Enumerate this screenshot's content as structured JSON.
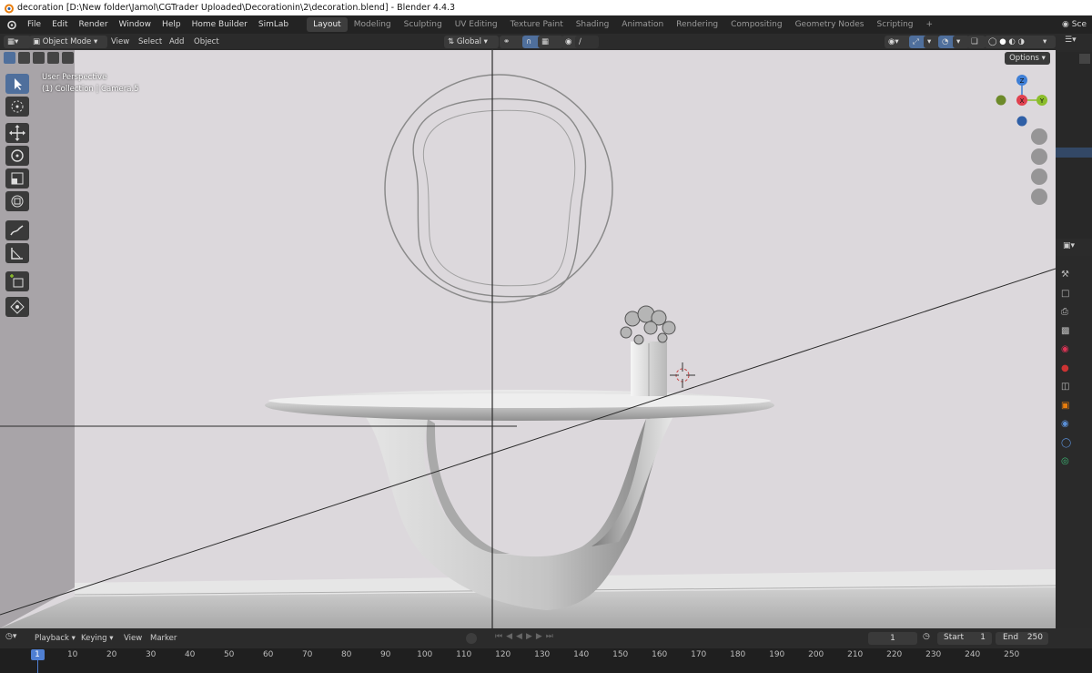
{
  "window": {
    "title": "decoration [D:\\New folder\\Jamol\\CGTrader Uploaded\\Decorationin\\2\\decoration.blend] - Blender 4.4.3"
  },
  "menubar": {
    "menus": [
      "File",
      "Edit",
      "Render",
      "Window",
      "Help",
      "Home Builder",
      "SimLab"
    ],
    "workspaces": [
      "Layout",
      "Modeling",
      "Sculpting",
      "UV Editing",
      "Texture Paint",
      "Shading",
      "Animation",
      "Rendering",
      "Compositing",
      "Geometry Nodes",
      "Scripting"
    ],
    "active_workspace": "Layout",
    "add_workspace": "+",
    "scene_label": "Sce"
  },
  "header3d": {
    "mode": "Object Mode",
    "menus": [
      "View",
      "Select",
      "Add",
      "Object"
    ],
    "orientation": "Global"
  },
  "viewport": {
    "perspective_label": "User Perspective",
    "collection_label": "(1) Collection | Camera.5",
    "options_button": "Options",
    "gizmo": {
      "z": "Z",
      "x": "X",
      "y": "Y"
    }
  },
  "timeline": {
    "menus": [
      "Playback",
      "Keying",
      "View",
      "Marker"
    ],
    "current_frame": "1",
    "start_label": "Start",
    "start_value": "1",
    "end_label": "End",
    "end_value": "250",
    "frames": [
      "1",
      "10",
      "20",
      "30",
      "40",
      "50",
      "60",
      "70",
      "80",
      "90",
      "100",
      "110",
      "120",
      "130",
      "140",
      "150",
      "160",
      "170",
      "180",
      "190",
      "200",
      "210",
      "220",
      "230",
      "240",
      "250"
    ]
  },
  "colors": {
    "accent": "#4f6f9c",
    "viewport_bg": "#d9d5d9",
    "axis_x": "#e0414f",
    "axis_y": "#8bbd2b",
    "axis_z": "#3f7fd6"
  }
}
